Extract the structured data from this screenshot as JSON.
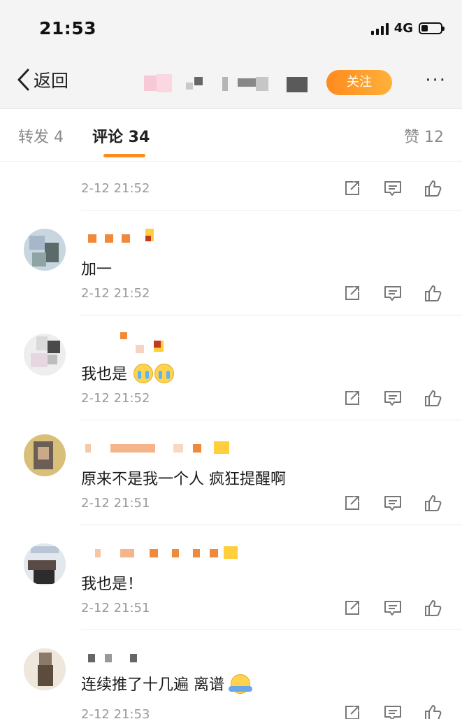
{
  "status": {
    "time": "21:53",
    "network": "4G"
  },
  "nav": {
    "back_label": "返回",
    "follow_label": "关注",
    "more_label": "···"
  },
  "tabs": [
    {
      "label": "转发 4",
      "active": false
    },
    {
      "label": "评论 34",
      "active": true
    },
    {
      "label": "赞 12",
      "active": false
    }
  ],
  "comments": [
    {
      "text": "",
      "time": "2-12 21:52"
    },
    {
      "text": "加一",
      "time": "2-12 21:52"
    },
    {
      "text": "我也是",
      "emoji": "crying-face",
      "time": "2-12 21:52"
    },
    {
      "text": "原来不是我一个人 疯狂提醒啊",
      "time": "2-12 21:51"
    },
    {
      "text": "我也是！",
      "time": "2-12 21:51"
    },
    {
      "text": "连续推了十几遍 离谱",
      "emoji": "shrug",
      "time": "2-12 21:53"
    }
  ],
  "colors": {
    "accent": "#ff8a1e",
    "text": "#1a1a1a",
    "muted": "#9a9a9a",
    "divider": "#ececec"
  },
  "icons": {
    "share": "share-icon",
    "comment": "comment-icon",
    "like": "like-icon"
  }
}
